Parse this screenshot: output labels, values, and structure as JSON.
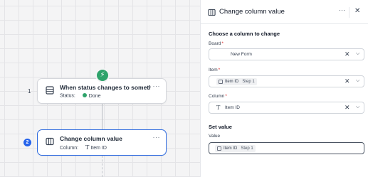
{
  "canvas": {
    "trigger_node": {
      "index": "1",
      "title": "When status changes to somethi...",
      "status_label": "Status:",
      "status_value": "Done",
      "badge_icon": "lightning-icon",
      "more_label": "···"
    },
    "action_node": {
      "index": "2",
      "title": "Change column value",
      "column_label": "Column:",
      "column_value": "Item ID",
      "more_label": "···"
    }
  },
  "panel": {
    "title": "Change column value",
    "more_label": "···",
    "close_label": "✕",
    "section_choose": "Choose a column to change",
    "board": {
      "label": "Board",
      "required": "*",
      "value": "New Form"
    },
    "item": {
      "label": "Item",
      "required": "*",
      "chip_label": "Item ID",
      "chip_step": "Step 1"
    },
    "column": {
      "label": "Column",
      "required": "*",
      "value": "Item ID"
    },
    "section_set": "Set value",
    "value": {
      "label": "Value",
      "chip_label": "Item ID",
      "chip_step": "Step 1"
    },
    "clear_label": "✕",
    "chevron_label": "⌄"
  },
  "colors": {
    "accent": "#2d6ae0",
    "success": "#2fa36b",
    "required": "#dc2626"
  }
}
